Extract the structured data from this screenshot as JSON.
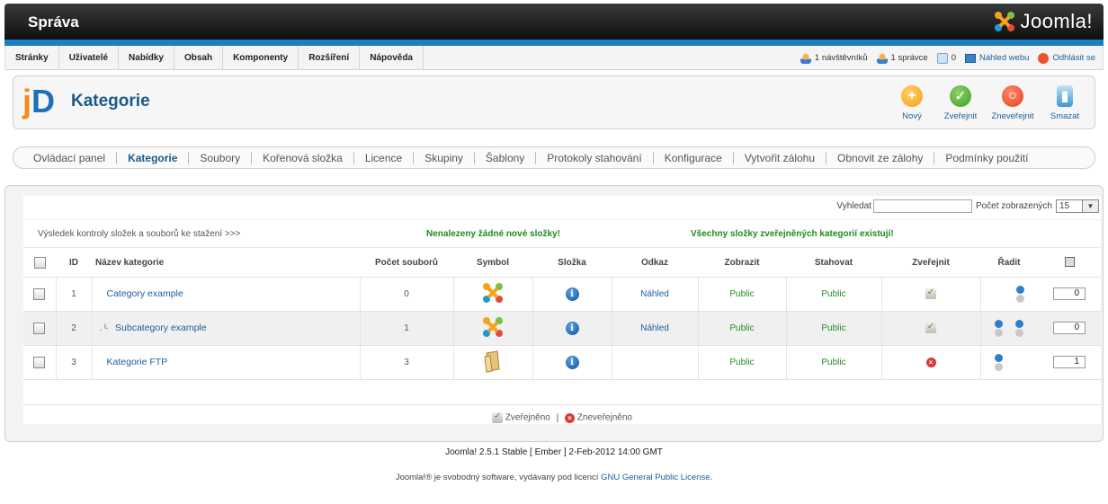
{
  "header": {
    "title": "Správa",
    "brand": "Joomla!"
  },
  "menu": [
    "Stránky",
    "Uživatelé",
    "Nabídky",
    "Obsah",
    "Komponenty",
    "Rozšíření",
    "Nápověda"
  ],
  "status": {
    "visitors": "1 návštěvníků",
    "admins": "1 správce",
    "messages": "0",
    "preview": "Náhled webu",
    "logout": "Odhlásit se"
  },
  "toolbar": {
    "page_title": "Kategorie",
    "logo_j": "j",
    "logo_d": "D",
    "new_label": "Nový",
    "publish_label": "Zveřejnit",
    "unpublish_label": "Zneveřejnit",
    "delete_label": "Smazat"
  },
  "tabs": [
    "Ovládací panel",
    "Kategorie",
    "Soubory",
    "Kořenová složka",
    "Licence",
    "Skupiny",
    "Šablony",
    "Protokoly stahování",
    "Konfigurace",
    "Vytvořit zálohu",
    "Obnovit ze zálohy",
    "Podmínky použití"
  ],
  "active_tab": "Kategorie",
  "filter": {
    "search_label": "Vyhledat",
    "search_value": "",
    "limit_label": "Počet zobrazených",
    "limit_value": "15"
  },
  "messages": {
    "check_link": "Výsledek kontroly složek a souborů ke stažení >>>",
    "no_new_folders": "Nenalezeny žádné nové složky!",
    "all_exist": "Všechny složky zveřejněných kategorií existují!"
  },
  "table": {
    "headers": {
      "id": "ID",
      "name": "Název kategorie",
      "count": "Počet souborů",
      "symbol": "Symbol",
      "folder": "Složka",
      "link": "Odkaz",
      "view": "Zobrazit",
      "download": "Stahovat",
      "publish": "Zveřejnit",
      "order": "Řadit"
    },
    "rows": [
      {
        "id": "1",
        "prefix": "",
        "name": "Category example",
        "count": "0",
        "symbol": "joomla",
        "link": "Náhled",
        "view": "Public",
        "download": "Public",
        "published": true,
        "order": "0"
      },
      {
        "id": "2",
        "prefix": ". ᴸ",
        "name": "Subcategory example",
        "count": "1",
        "symbol": "joomla",
        "link": "Náhled",
        "view": "Public",
        "download": "Public",
        "published": true,
        "order": "0"
      },
      {
        "id": "3",
        "prefix": "",
        "name": "Kategorie FTP",
        "count": "3",
        "symbol": "folder",
        "link": "",
        "view": "Public",
        "download": "Public",
        "published": false,
        "order": "1"
      }
    ]
  },
  "legend": {
    "published": "Zveřejněno",
    "separator": "|",
    "unpublished": "Zneveřejněno"
  },
  "footer": {
    "version": "Joomla! 2.5.1 Stable [ Ember ] 2-Feb-2012 14:00 GMT",
    "license_prefix": "Joomla!® je svobodný software, vydávaný pod licencí",
    "license_link": "GNU General Public License",
    "license_suffix": "."
  },
  "colors": {
    "accent": "#1d7fc3",
    "public": "#2b8a2b",
    "title": "#1a5a8c"
  }
}
